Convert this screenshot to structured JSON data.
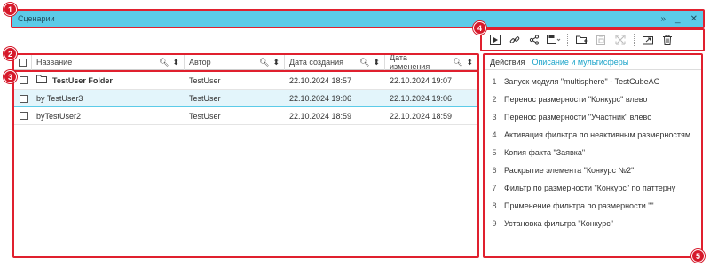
{
  "window": {
    "title": "Сценарии",
    "controls": [
      "»",
      "_",
      "✕"
    ]
  },
  "toolbar": {
    "buttons": [
      {
        "icon": "play-icon",
        "glyph": "▶"
      },
      {
        "icon": "link-icon",
        "glyph": "🔗"
      },
      {
        "icon": "share-icon",
        "glyph": "⋈"
      },
      {
        "icon": "save-icon",
        "glyph": "💾"
      },
      {
        "icon": "new-folder-icon",
        "glyph": "🗀"
      },
      {
        "icon": "paste-icon",
        "glyph": "📋"
      },
      {
        "icon": "expand-icon",
        "glyph": "⤡"
      },
      {
        "icon": "export-icon",
        "glyph": "⇪"
      },
      {
        "icon": "delete-icon",
        "glyph": "🗑"
      }
    ]
  },
  "grid": {
    "columns": {
      "name": "Название",
      "author": "Автор",
      "created": "Дата создания",
      "modified": "Дата изменения"
    },
    "rows": [
      {
        "name": "TestUser Folder",
        "author": "TestUser",
        "created": "22.10.2024 18:57",
        "modified": "22.10.2024 19:07"
      },
      {
        "name": "by TestUser3",
        "author": "TestUser",
        "created": "22.10.2024 19:06",
        "modified": "22.10.2024 19:06"
      },
      {
        "name": "byTestUser2",
        "author": "TestUser",
        "created": "22.10.2024 18:59",
        "modified": "22.10.2024 18:59"
      }
    ]
  },
  "panel": {
    "tab_actions": "Действия",
    "tab_description": "Описание и мультисферы",
    "actions": [
      {
        "num": "1",
        "text": "Запуск модуля \"multisphere\" - TestCubeAG"
      },
      {
        "num": "2",
        "text": "Перенос размерности \"Конкурс\" влево"
      },
      {
        "num": "3",
        "text": "Перенос размерности \"Участник\" влево"
      },
      {
        "num": "4",
        "text": "Активация фильтра по неактивным размерностям"
      },
      {
        "num": "5",
        "text": "Копия факта \"Заявка\""
      },
      {
        "num": "6",
        "text": "Раскрытие элемента \"Конкурс №2\""
      },
      {
        "num": "7",
        "text": "Фильтр по размерности \"Конкурс\" по паттерну"
      },
      {
        "num": "8",
        "text": "Применение фильтра по размерности \"\""
      },
      {
        "num": "9",
        "text": "Установка фильтра \"Конкурс\""
      }
    ]
  },
  "annotations": {
    "badge1": "1",
    "badge2": "2",
    "badge3": "3",
    "badge4": "4",
    "badge5": "5"
  },
  "colors": {
    "accent": "#5ccbe8",
    "annotation": "#e0202e",
    "link": "#1aa3c9"
  }
}
